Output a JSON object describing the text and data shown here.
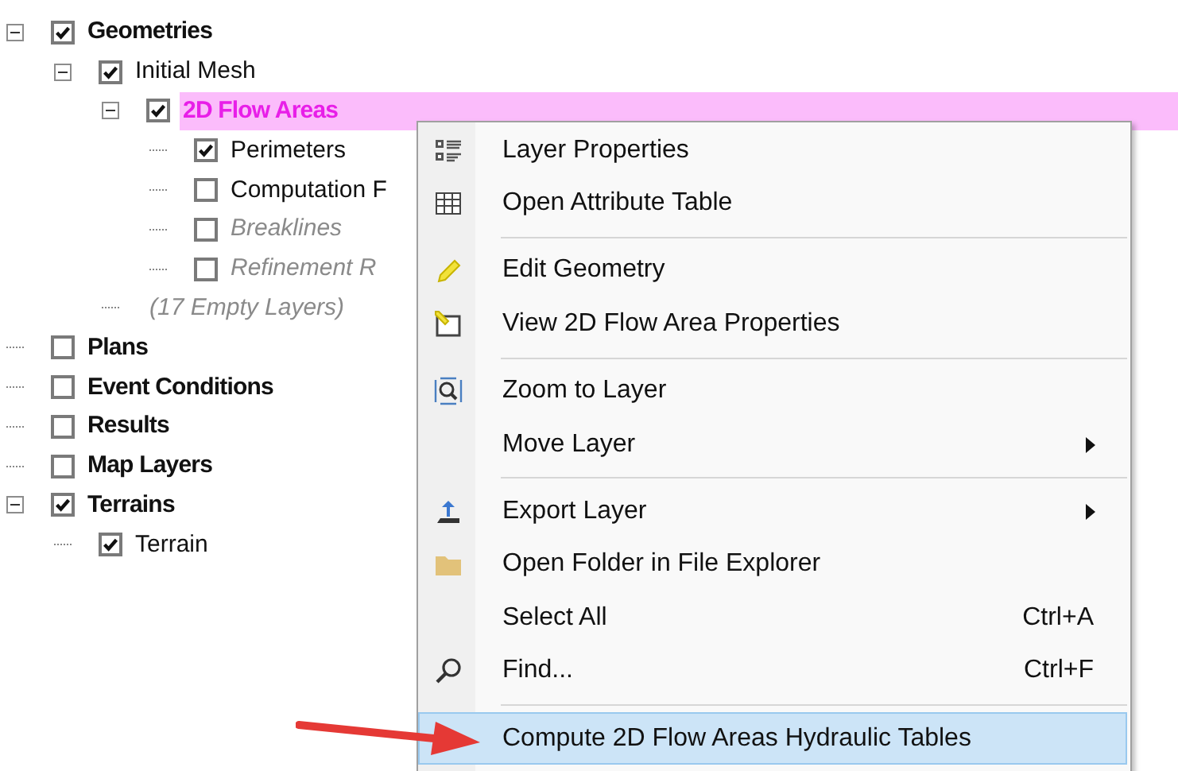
{
  "tree": [
    {
      "label": "Geometries",
      "kind": "group",
      "checked": true,
      "expanded": true,
      "selected": false,
      "children": [
        {
          "label": "Initial Mesh",
          "kind": "layer",
          "checked": true,
          "expanded": true,
          "selected": false,
          "children": [
            {
              "label": "2D Flow Areas",
              "kind": "group",
              "checked": true,
              "expanded": true,
              "selected": true,
              "children": [
                {
                  "label": "Perimeters",
                  "kind": "layer",
                  "checked": true,
                  "selected": false
                },
                {
                  "label": "Computation F",
                  "kind": "layer",
                  "checked": false,
                  "selected": false
                },
                {
                  "label": "Breaklines",
                  "kind": "empty_layer",
                  "checked": false,
                  "selected": false
                },
                {
                  "label": "Refinement R",
                  "kind": "empty_layer",
                  "checked": false,
                  "selected": false
                }
              ]
            },
            {
              "label": "(17 Empty Layers)",
              "kind": "note",
              "selected": false
            }
          ]
        }
      ]
    },
    {
      "label": "Plans",
      "kind": "group",
      "checked": false,
      "selected": false
    },
    {
      "label": "Event Conditions",
      "kind": "group",
      "checked": false,
      "selected": false
    },
    {
      "label": "Results",
      "kind": "group",
      "checked": false,
      "selected": false
    },
    {
      "label": "Map Layers",
      "kind": "group",
      "checked": false,
      "selected": false
    },
    {
      "label": "Terrains",
      "kind": "group",
      "checked": true,
      "expanded": true,
      "selected": false,
      "children": [
        {
          "label": "Terrain",
          "kind": "layer",
          "checked": true,
          "selected": false
        }
      ]
    }
  ],
  "context_menu": {
    "items": [
      {
        "kind": "item",
        "label": "Layer Properties",
        "highlighted": false
      },
      {
        "kind": "item",
        "label": "Open Attribute Table",
        "highlighted": false
      },
      {
        "kind": "separator"
      },
      {
        "kind": "item",
        "label": "Edit Geometry",
        "highlighted": false
      },
      {
        "kind": "item",
        "label": "View 2D Flow Area Properties",
        "highlighted": false
      },
      {
        "kind": "separator"
      },
      {
        "kind": "item",
        "label": "Zoom to Layer",
        "highlighted": false
      },
      {
        "kind": "item",
        "label": "Move Layer",
        "submenu": true,
        "highlighted": false
      },
      {
        "kind": "separator"
      },
      {
        "kind": "item",
        "label": "Export Layer",
        "submenu": true,
        "highlighted": false
      },
      {
        "kind": "item",
        "label": "Open Folder in File Explorer",
        "highlighted": false
      },
      {
        "kind": "item",
        "label": "Select All",
        "shortcut": "Ctrl+A",
        "highlighted": false
      },
      {
        "kind": "item",
        "label": "Find...",
        "shortcut": "Ctrl+F",
        "highlighted": false
      },
      {
        "kind": "separator"
      },
      {
        "kind": "item",
        "label": "Compute 2D Flow Areas Hydraulic Tables",
        "highlighted": true
      }
    ]
  }
}
